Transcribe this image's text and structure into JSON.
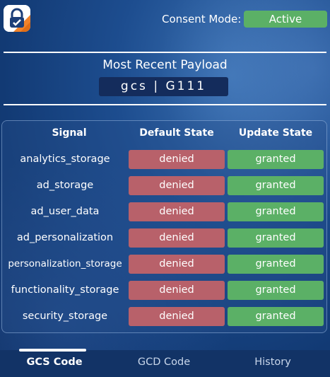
{
  "header": {
    "consent_label": "Consent Mode:",
    "consent_status": "Active",
    "logo_icon": "lock-shield-logo-icon"
  },
  "payload": {
    "title": "Most Recent Payload",
    "value": "gcs | G111"
  },
  "table": {
    "headers": [
      "Signal",
      "Default State",
      "Update State"
    ],
    "rows": [
      {
        "signal": "analytics_storage",
        "default": "denied",
        "update": "granted"
      },
      {
        "signal": "ad_storage",
        "default": "denied",
        "update": "granted"
      },
      {
        "signal": "ad_user_data",
        "default": "denied",
        "update": "granted"
      },
      {
        "signal": "ad_personalization",
        "default": "denied",
        "update": "granted"
      },
      {
        "signal": "personalization_storage",
        "default": "denied",
        "update": "granted"
      },
      {
        "signal": "functionality_storage",
        "default": "denied",
        "update": "granted"
      },
      {
        "signal": "security_storage",
        "default": "denied",
        "update": "granted"
      }
    ]
  },
  "tabs": [
    "GCS Code",
    "GCD Code",
    "History"
  ],
  "colors": {
    "granted": "#5bb066",
    "denied": "#b8616a",
    "background": "#1d4d8f"
  }
}
